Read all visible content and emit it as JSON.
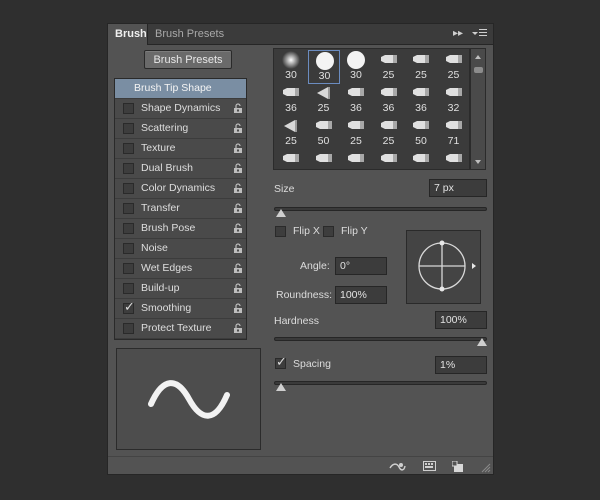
{
  "tabs": [
    {
      "label": "Brush"
    },
    {
      "label": "Brush Presets"
    }
  ],
  "panel_menu": {
    "collapse_icon": "double-chevron-right-icon",
    "menu_icon": "panel-menu-icon"
  },
  "presets_button": {
    "label": "Brush Presets"
  },
  "options": [
    {
      "label": "Brush Tip Shape",
      "selected": true
    },
    {
      "label": "Shape Dynamics",
      "checked": false,
      "locked": true
    },
    {
      "label": "Scattering",
      "checked": false,
      "locked": true
    },
    {
      "label": "Texture",
      "checked": false,
      "locked": true
    },
    {
      "label": "Dual Brush",
      "checked": false,
      "locked": true
    },
    {
      "label": "Color Dynamics",
      "checked": false,
      "locked": true
    },
    {
      "label": "Transfer",
      "checked": false,
      "locked": true
    },
    {
      "label": "Brush Pose",
      "checked": false,
      "locked": true
    },
    {
      "label": "Noise",
      "checked": false,
      "locked": true
    },
    {
      "label": "Wet Edges",
      "checked": false,
      "locked": true
    },
    {
      "label": "Build-up",
      "checked": false,
      "locked": true
    },
    {
      "label": "Smoothing",
      "checked": true,
      "locked": true
    },
    {
      "label": "Protect Texture",
      "checked": false,
      "locked": true
    }
  ],
  "brush_tips": [
    {
      "size": "30",
      "shape": "soft-round"
    },
    {
      "size": "30",
      "shape": "hard-round",
      "selected": true
    },
    {
      "size": "30",
      "shape": "hard-round"
    },
    {
      "size": "25",
      "shape": "bristle"
    },
    {
      "size": "25",
      "shape": "bristle"
    },
    {
      "size": "25",
      "shape": "bristle"
    },
    {
      "size": "36",
      "shape": "bristle"
    },
    {
      "size": "25",
      "shape": "fan"
    },
    {
      "size": "36",
      "shape": "bristle"
    },
    {
      "size": "36",
      "shape": "bristle"
    },
    {
      "size": "36",
      "shape": "bristle"
    },
    {
      "size": "32",
      "shape": "bristle"
    },
    {
      "size": "25",
      "shape": "fan"
    },
    {
      "size": "50",
      "shape": "bristle"
    },
    {
      "size": "25",
      "shape": "bristle"
    },
    {
      "size": "25",
      "shape": "bristle"
    },
    {
      "size": "50",
      "shape": "bristle"
    },
    {
      "size": "71",
      "shape": "bristle"
    },
    {
      "size": "25",
      "shape": "bristle"
    },
    {
      "size": "50",
      "shape": "bristle"
    },
    {
      "size": "50",
      "shape": "bristle"
    },
    {
      "size": "50",
      "shape": "bristle"
    },
    {
      "size": "50",
      "shape": "bristle"
    },
    {
      "size": "50",
      "shape": "bristle"
    }
  ],
  "size": {
    "label": "Size",
    "value": "7 px",
    "fraction": 0.01
  },
  "flip_x": {
    "label": "Flip X",
    "checked": false
  },
  "flip_y": {
    "label": "Flip Y",
    "checked": false
  },
  "angle": {
    "label": "Angle:",
    "value": "0°"
  },
  "roundness": {
    "label": "Roundness:",
    "value": "100%"
  },
  "hardness": {
    "label": "Hardness",
    "value": "100%",
    "fraction": 1.0
  },
  "spacing": {
    "label": "Spacing",
    "value": "1%",
    "checked": true,
    "fraction": 0.01
  },
  "footer_icons": [
    "toggle-brush-preview-icon",
    "grid-icon",
    "new-preset-icon"
  ],
  "colors": {
    "panel": "#535353",
    "selected_row": "#7a8ea3",
    "background": "#2f2f2f"
  }
}
